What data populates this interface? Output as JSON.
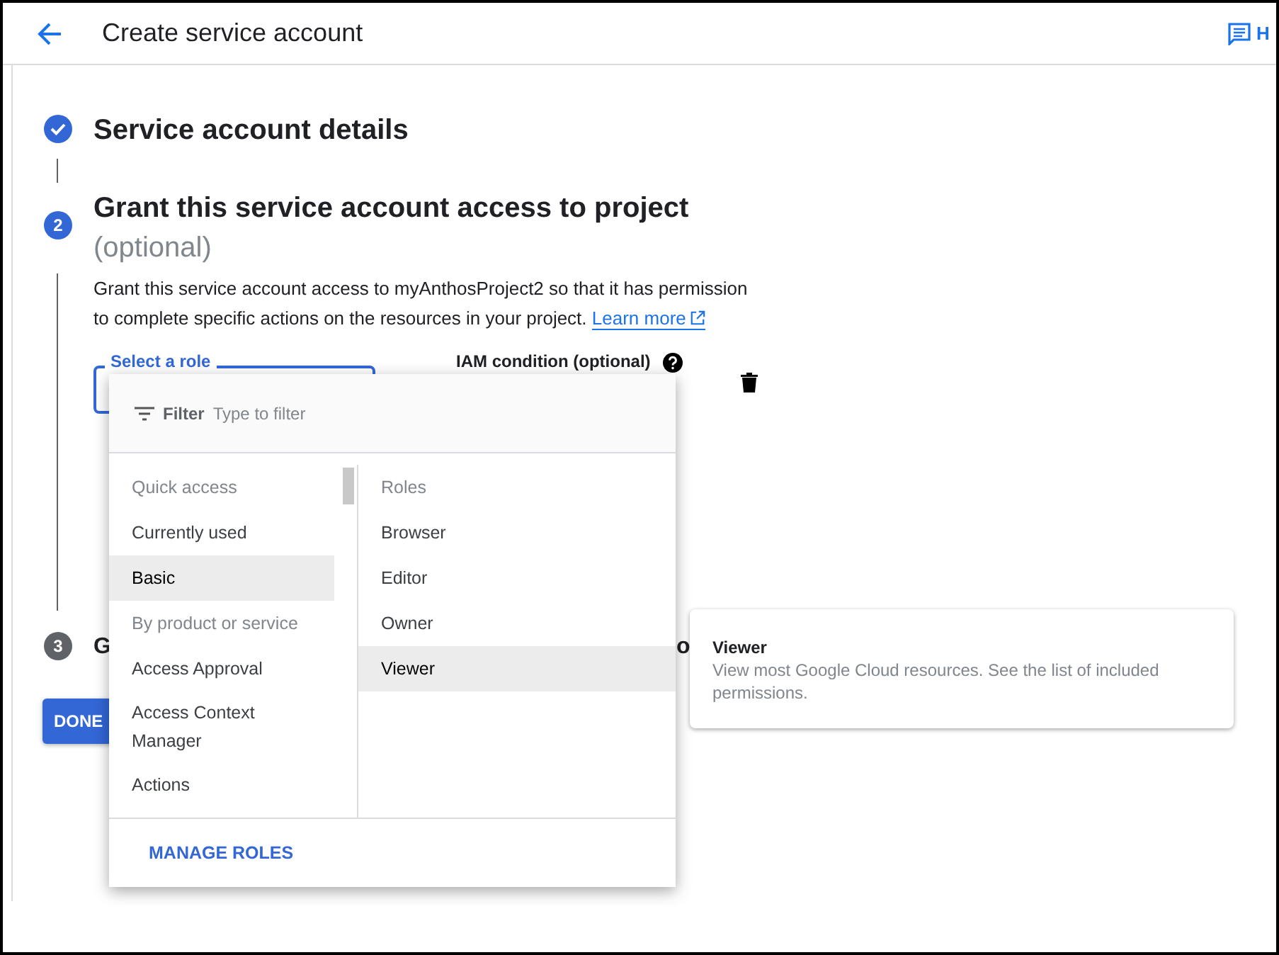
{
  "header": {
    "title": "Create service account",
    "help_label": "H"
  },
  "steps": [
    {
      "kind": "done",
      "title": "Service account details"
    },
    {
      "kind": "active",
      "number": "2",
      "title": "Grant this service account access to project",
      "subtitle": "(optional)"
    },
    {
      "kind": "pending",
      "number": "3",
      "title": "G",
      "title_tail": "o"
    }
  ],
  "description": {
    "text": "Grant this service account access to myAnthosProject2 so that it has permission to complete specific actions on the resources in your project.",
    "link": "Learn more"
  },
  "role_field": {
    "label": "Select a role"
  },
  "iam_condition": {
    "label": "IAM condition (optional)"
  },
  "done_button": "DONE",
  "role_menu": {
    "filter_label": "Filter",
    "filter_placeholder": "Type to filter",
    "categories": [
      {
        "kind": "header",
        "label": "Quick access"
      },
      {
        "kind": "item",
        "label": "Currently used",
        "selected": false
      },
      {
        "kind": "item",
        "label": "Basic",
        "selected": true
      },
      {
        "kind": "header",
        "label": "By product or service"
      },
      {
        "kind": "item",
        "label": "Access Approval",
        "selected": false
      },
      {
        "kind": "item",
        "label": "Access Context Manager",
        "selected": false
      },
      {
        "kind": "item",
        "label": "Actions",
        "selected": false
      }
    ],
    "roles_header": "Roles",
    "roles": [
      {
        "label": "Browser",
        "selected": false
      },
      {
        "label": "Editor",
        "selected": false
      },
      {
        "label": "Owner",
        "selected": false
      },
      {
        "label": "Viewer",
        "selected": true
      }
    ],
    "footer_button": "MANAGE ROLES"
  },
  "tooltip": {
    "title": "Viewer",
    "description": "View most Google Cloud resources. See the list of included permissions."
  }
}
